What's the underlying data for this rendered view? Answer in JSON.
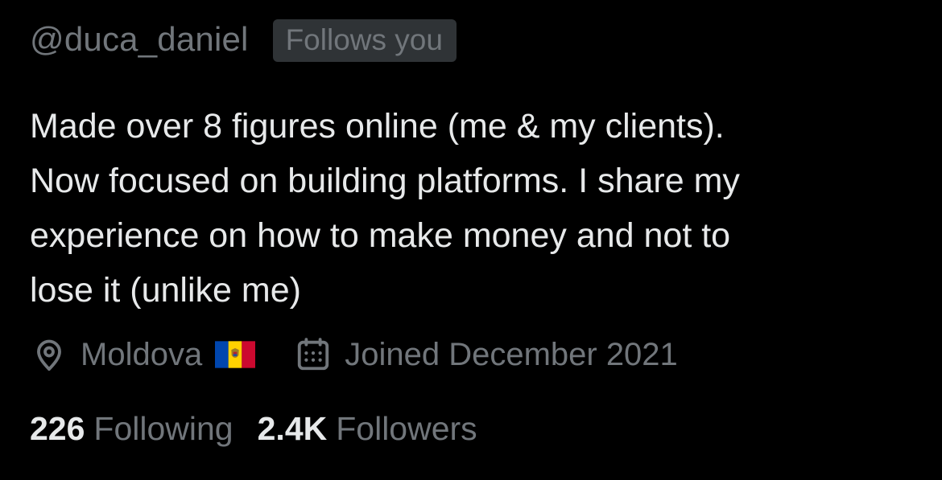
{
  "profile": {
    "handle": "@duca_daniel",
    "follows_you_badge": "Follows you",
    "bio_lines": [
      "Made over 8 figures online (me & my clients).",
      "Now focused on building platforms. I share my",
      "experience on how to make money and not to",
      "lose it (unlike me)"
    ],
    "location": "Moldova",
    "location_flag": "moldova-flag",
    "joined": "Joined December 2021",
    "following_count": "226",
    "following_label": "Following",
    "followers_count": "2.4K",
    "followers_label": "Followers"
  },
  "icons": {
    "location": "location-pin-icon",
    "calendar": "calendar-icon"
  },
  "colors": {
    "background": "#000000",
    "primary_text": "#e7e9ea",
    "secondary_text": "#71767b",
    "badge_background": "#2f3336",
    "flag_blue": "#0046ae",
    "flag_yellow": "#ffd200",
    "flag_red": "#cc092f"
  }
}
